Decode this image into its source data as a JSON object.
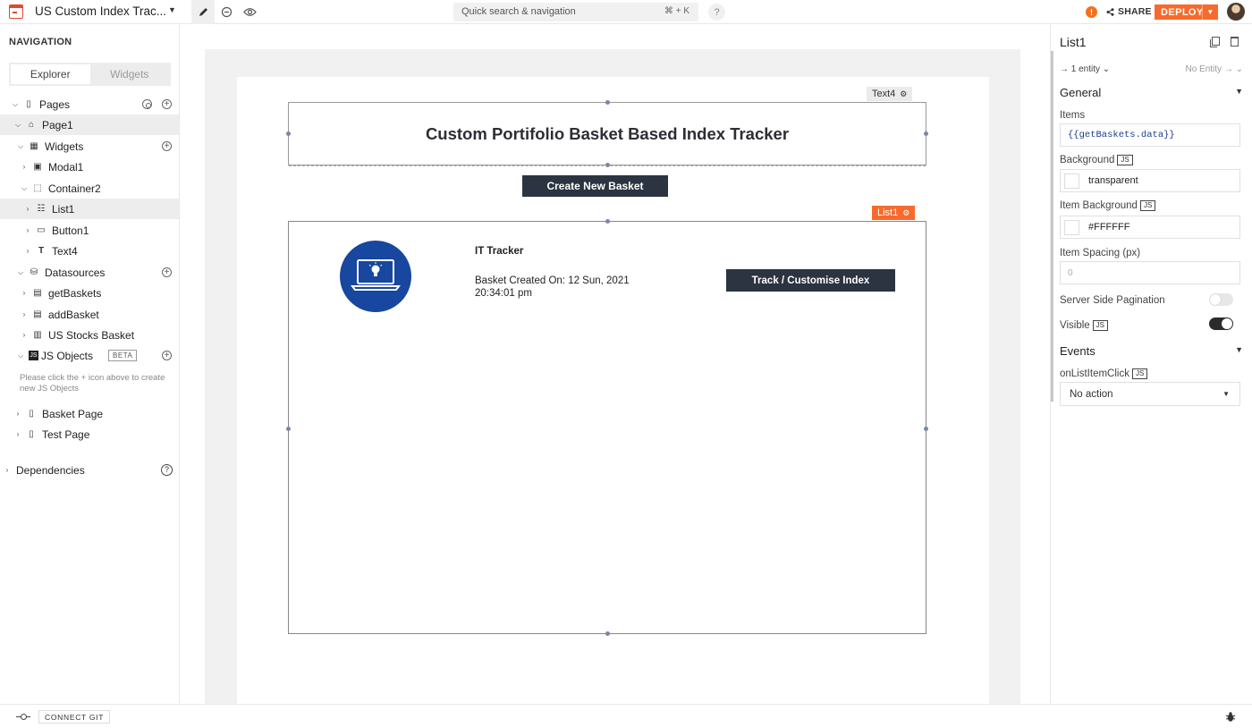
{
  "topbar": {
    "app_title": "US Custom Index Trac...",
    "search_placeholder": "Quick search & navigation",
    "search_shortcut": "⌘ + K",
    "help": "?",
    "share_label": "SHARE",
    "deploy_label": "DEPLOY",
    "warning": "!"
  },
  "sidebar": {
    "heading": "NAVIGATION",
    "tabs": [
      "Explorer",
      "Widgets"
    ],
    "tree": {
      "pages": "Pages",
      "page1": "Page1",
      "widgets": "Widgets",
      "modal1": "Modal1",
      "container2": "Container2",
      "list1": "List1",
      "button1": "Button1",
      "text4": "Text4",
      "datasources": "Datasources",
      "getbaskets": "getBaskets",
      "addbasket": "addBasket",
      "us_stocks_basket": "US Stocks Basket",
      "js_objects": "JS Objects",
      "beta": "BETA",
      "js_hint": "Please click the + icon above to create new JS Objects",
      "basket_page": "Basket Page",
      "test_page": "Test Page",
      "dependencies": "Dependencies"
    }
  },
  "canvas": {
    "text4_tag": "Text4",
    "text4_content": "Custom Portifolio Basket Based Index Tracker",
    "create_button": "Create New Basket",
    "list1_tag": "List1",
    "list_item": {
      "title": "IT Tracker",
      "created": "Basket Created On: 12 Sun, 2021 20:34:01 pm",
      "track_button": "Track / Customise Index"
    }
  },
  "properties": {
    "widget_name": "List1",
    "entity_left": "1 entity",
    "entity_right": "No Entity",
    "general": "General",
    "items_label": "Items",
    "items_value": "{{getBaskets.data}}",
    "background_label": "Background",
    "background_value": "transparent",
    "item_background_label": "Item Background",
    "item_background_value": "#FFFFFF",
    "item_spacing_label": "Item Spacing (px)",
    "item_spacing_value": "0",
    "server_pagination_label": "Server Side Pagination",
    "server_pagination_on": false,
    "visible_label": "Visible",
    "visible_on": true,
    "js_badge": "JS",
    "events": "Events",
    "on_click_label": "onListItemClick",
    "on_click_value": "No action"
  },
  "bottombar": {
    "connect_git": "CONNECT GIT"
  },
  "colors": {
    "accent": "#f86a2b",
    "dark_button": "#2b3440",
    "image_blue": "#17479e"
  }
}
